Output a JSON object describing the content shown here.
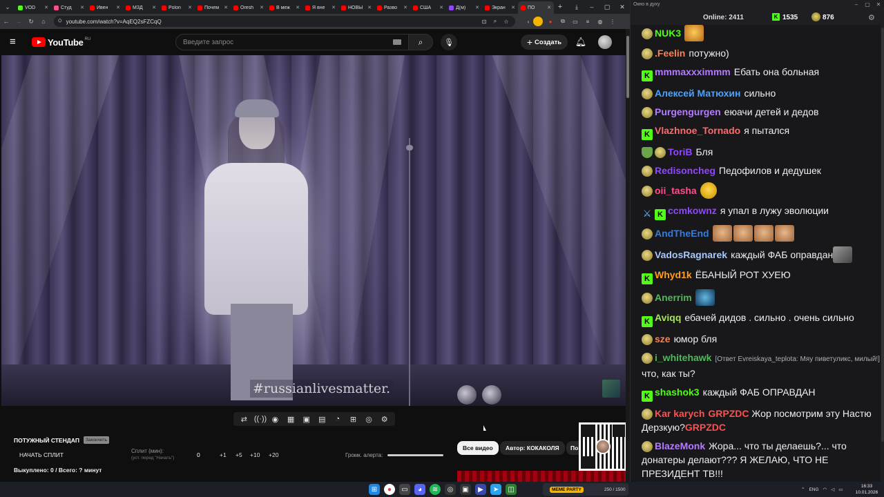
{
  "browser": {
    "tabs": [
      {
        "label": "VOD",
        "color": "#53fc18",
        "active": false
      },
      {
        "label": "Студ",
        "color": "#ff4f8b",
        "active": false
      },
      {
        "label": "Ивен",
        "color": "#ff0000",
        "active": false
      },
      {
        "label": "МЗД",
        "color": "#ff0000",
        "active": false
      },
      {
        "label": "Polon",
        "color": "#ff0000",
        "active": false
      },
      {
        "label": "Почем",
        "color": "#ff0000",
        "active": false
      },
      {
        "label": "Oresh",
        "color": "#ff0000",
        "active": false
      },
      {
        "label": "В меж",
        "color": "#ff0000",
        "active": false
      },
      {
        "label": "Я вне",
        "color": "#ff0000",
        "active": false
      },
      {
        "label": "НОВЫ",
        "color": "#ff0000",
        "active": false
      },
      {
        "label": "Разво",
        "color": "#ff0000",
        "active": false
      },
      {
        "label": "США",
        "color": "#ff0000",
        "active": false
      },
      {
        "label": "Д(м)",
        "color": "#9146ff",
        "active": false
      },
      {
        "label": "Экран",
        "color": "#ff0000",
        "active": false
      },
      {
        "label": "ПО",
        "color": "#ff0000",
        "active": true
      }
    ],
    "url": "youtube.com/watch?v=AqEQ2sFZCqQ"
  },
  "youtube": {
    "logo_text": "YouTube",
    "region": "RU",
    "search_placeholder": "Введите запрос",
    "create_label": "Создать",
    "video_overlay_text": "#russianlivesmatter.",
    "toolbar_icons": [
      "loop-icon",
      "broadcast-icon",
      "eye-icon",
      "clapper-icon",
      "picture-in-picture-icon",
      "layout-icon",
      "speed-icon",
      "add-icon",
      "camera-icon",
      "gear-icon"
    ],
    "toolbar_glyphs": [
      "⇄",
      "((·))",
      "◉",
      "▦",
      "▣",
      "▤",
      "◔",
      "⊞",
      "◎",
      "⚙"
    ]
  },
  "panel": {
    "title": "ПОТУЖНЫЙ СТЕНДАП",
    "title_badge": "Закончить",
    "start_split": "НАЧАТЬ СПЛИТ",
    "split_label": "Сплит (мин):",
    "split_hint": "(уст. перед \"Начать\")",
    "split_value": "0",
    "split_buttons": [
      "+1",
      "+5",
      "+10",
      "+20"
    ],
    "purchased": "Выкуплено: 0 / Всего: ? минут",
    "volume_label": "Громк. алерта:",
    "volume_level": 1.0,
    "filter_all": "Все видео",
    "filter_author": "Автор: КОКАКОЛЯ",
    "filter_more": "По"
  },
  "chat_window": {
    "title": "Окно в духу",
    "online_label": "Online:",
    "online_value": "2411",
    "kick_count": "1535",
    "twitch_count": "876",
    "messages": [
      {
        "badges": [
          "troll"
        ],
        "user": "NUK3",
        "color": "#53fc18",
        "text": "",
        "emote": "crazy"
      },
      {
        "badges": [
          "troll"
        ],
        "user": ".Feelin",
        "color": "#ff7f50",
        "text": "потужно)"
      },
      {
        "badges": [
          "k"
        ],
        "user": "mmmaxxximmm",
        "color": "#b57cff",
        "text": "Ебать она больная"
      },
      {
        "badges": [
          "troll"
        ],
        "user": "Алексей Матюхин",
        "color": "#4aa3ff",
        "text": "сильно"
      },
      {
        "badges": [
          "troll"
        ],
        "user": "Purgengurgen",
        "color": "#b57cff",
        "text": "еюачи детей и дедов"
      },
      {
        "badges": [
          "k"
        ],
        "user": "Vlazhnoe_Tornado",
        "color": "#ff6b6b",
        "text": "я пытался"
      },
      {
        "badges": [
          "shield",
          "troll"
        ],
        "user": "ToriB",
        "color": "#9146ff",
        "text": "Бля"
      },
      {
        "badges": [
          "troll"
        ],
        "user": "Redisoncheg",
        "color": "#9146ff",
        "text": "Педофилов и дедушек"
      },
      {
        "badges": [
          "troll"
        ],
        "user": "oii_tasha",
        "color": "#ff4f8b",
        "text": "",
        "emote": "cool"
      },
      {
        "badges": [
          "sword",
          "k"
        ],
        "user": "ccmkownz",
        "color": "#9146ff",
        "text": "я упал в лужу эволюции"
      },
      {
        "badges": [
          "troll"
        ],
        "user": "AndTheEnd",
        "color": "#3a7bd5",
        "text": "",
        "emote": "cats"
      },
      {
        "badges": [
          "troll"
        ],
        "user": "VadosRagnarek",
        "color": "#a7c8ff",
        "text": "каждый ФАБ оправдан",
        "emote": "photo"
      },
      {
        "badges": [
          "k"
        ],
        "user": "Whyd1k",
        "color": "#ff9f1c",
        "text": "ЁБАНЫЙ РОТ ХУЕЮ"
      },
      {
        "badges": [
          "troll"
        ],
        "user": "Anerrim",
        "color": "#53b85a",
        "text": "",
        "emote": "eye"
      },
      {
        "badges": [
          "k"
        ],
        "user": "Aviqq",
        "color": "#a7e35a",
        "text": "ебачей дидов . сильно . очень сильно"
      },
      {
        "badges": [
          "troll"
        ],
        "user": "sze",
        "color": "#ff7f50",
        "text": "юмор бля"
      },
      {
        "badges": [
          "troll"
        ],
        "user": "i_whitehawk",
        "color": "#53b85a",
        "reply": "[Ответ Evreiskaya_teplota: Мяу пиветуликс, милый!]",
        "text": "что, как ты?"
      },
      {
        "badges": [
          "k"
        ],
        "user": "shashok3",
        "color": "#53fc18",
        "text": "каждый ФАБ ОПРАВДАН"
      },
      {
        "badges": [
          "troll"
        ],
        "user": "Kar karych",
        "color": "#ff4f4f",
        "text": "Жор посмотрим эту Настю Дерзкую?",
        "emote_text": "GRPZDC"
      },
      {
        "badges": [
          "troll"
        ],
        "user": "BlazeMonk",
        "color": "#b57cff",
        "text": "Жора... что ты делаешь?... что донатеры делают??? Я ЖЕЛАЮ, ЧТО НЕ ПРЕЗИДЕНТ ТВ!!!"
      }
    ]
  },
  "taskbar": {
    "widget_label": "MEME PARTY",
    "widget_score": "250 / 1500",
    "language": "ENG",
    "time": "16:33",
    "date": "10.01.2026"
  }
}
